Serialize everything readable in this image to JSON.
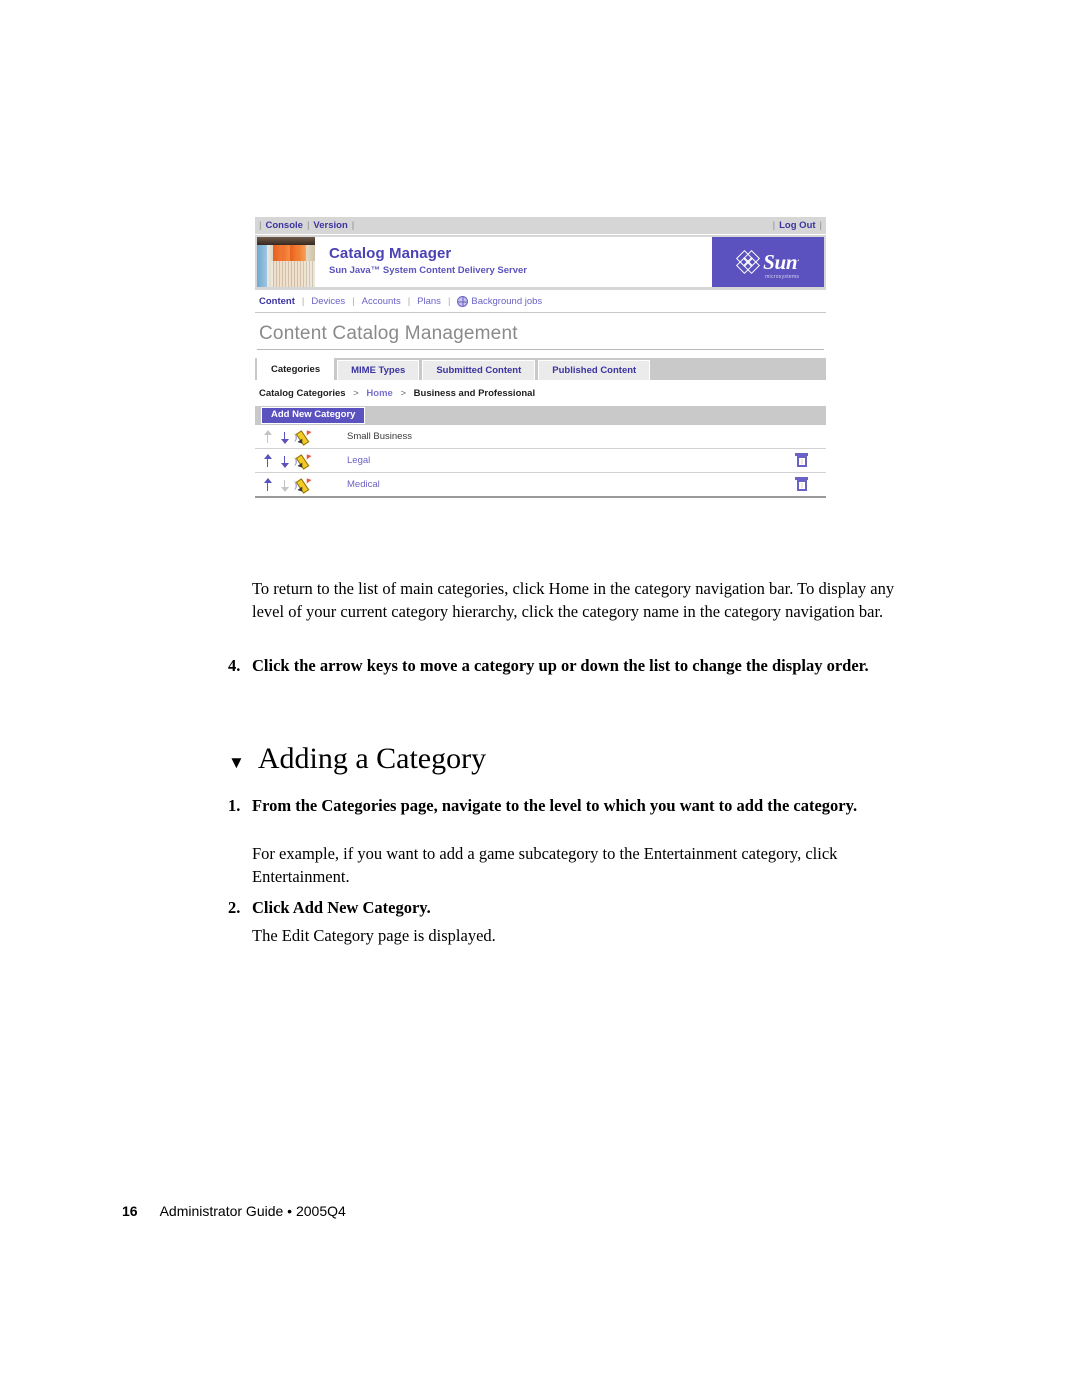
{
  "screenshot": {
    "utility_bar": {
      "links": [
        "Console",
        "Version"
      ],
      "logout_label": "Log Out",
      "separator": "|"
    },
    "banner": {
      "product_title": "Catalog Manager",
      "product_subtitle": "Sun Java™ System Content Delivery Server",
      "logo_word": "Sun",
      "logo_tm": ".",
      "logo_microsystems": "microsystems",
      "photo_alt": "bookshelf-photo"
    },
    "module_nav": {
      "items": [
        {
          "label": "Content",
          "current": true
        },
        {
          "label": "Devices",
          "current": false
        },
        {
          "label": "Accounts",
          "current": false
        },
        {
          "label": "Plans",
          "current": false
        },
        {
          "label": "Background jobs",
          "current": false,
          "icon": "globe-icon"
        }
      ],
      "separator": "|"
    },
    "page_heading": "Content Catalog Management",
    "tabs": [
      {
        "label": "Categories",
        "active": true
      },
      {
        "label": "MIME Types",
        "active": false
      },
      {
        "label": "Submitted Content",
        "active": false
      },
      {
        "label": "Published Content",
        "active": false
      }
    ],
    "breadcrumb": {
      "root": "Catalog Categories",
      "separator": ">",
      "link": "Home",
      "current": "Business and Professional"
    },
    "action_bar": {
      "add_button_label": "Add New Category"
    },
    "categories": [
      {
        "name": "Small Business",
        "is_link": false,
        "up_enabled": false,
        "down_enabled": true,
        "has_delete": false
      },
      {
        "name": "Legal",
        "is_link": true,
        "up_enabled": true,
        "down_enabled": true,
        "has_delete": true
      },
      {
        "name": "Medical",
        "is_link": true,
        "up_enabled": true,
        "down_enabled": false,
        "has_delete": true
      }
    ],
    "colors": {
      "brand_purple": "#5b52bf",
      "link_blue": "#6a62c6",
      "toolbar_gray": "#c9c9c9",
      "bar_gray": "#d6d6d6"
    }
  },
  "document": {
    "paragraph_1": "To return to the list of main categories, click Home in the category navigation bar. To display any level of your current category hierarchy, click the category name in the category navigation bar.",
    "step_4": {
      "number": "4.",
      "text": "Click the arrow keys to move a category up or down the list to change the display order."
    },
    "section_heading": {
      "marker": "▼",
      "title": "Adding a Category"
    },
    "step_1": {
      "number": "1.",
      "text": "From the Categories page, navigate to the level to which you want to add the category."
    },
    "paragraph_2": "For example, if you want to add a game subcategory to the Entertainment category, click Entertainment.",
    "step_2": {
      "number": "2.",
      "text": "Click Add New Category."
    },
    "paragraph_3": "The Edit Category page is displayed.",
    "footer": {
      "page_number": "16",
      "text": "Administrator Guide • 2005Q4"
    }
  }
}
